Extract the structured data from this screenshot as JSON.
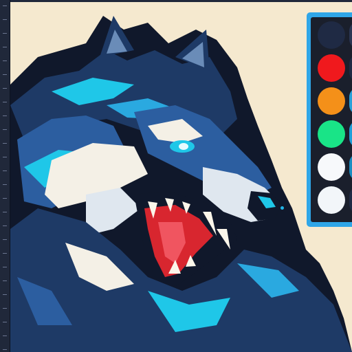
{
  "palette": {
    "swatches": [
      {
        "name": "swatch-navy",
        "color": "#1f2a44"
      },
      {
        "name": "swatch-red",
        "color": "#f0191d"
      },
      {
        "name": "swatch-orange",
        "color": "#f49019"
      },
      {
        "name": "swatch-green",
        "color": "#19e487"
      },
      {
        "name": "swatch-white-1",
        "color": "#f7f9fb"
      },
      {
        "name": "swatch-white-2",
        "color": "#f2f6f9"
      }
    ],
    "edge_colors": [
      "#2a3552",
      "#1f2a44",
      "#2aa0d8",
      "#1f9ed8",
      "#1a8cc0",
      "#1f2a44"
    ]
  },
  "colors": {
    "canvas_bg": "#f5e9cf",
    "accent": "#2fa6e8"
  }
}
